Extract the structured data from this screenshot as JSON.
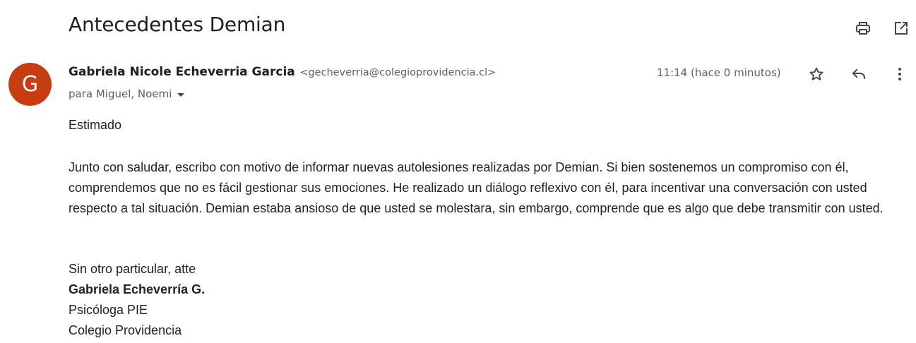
{
  "email": {
    "subject": "Antecedentes Demian",
    "sender": {
      "avatar_letter": "G",
      "name": "Gabriela Nicole Echeverria Garcia",
      "email": "<gecheverria@colegioprovidencia.cl>"
    },
    "recipients": "para Miguel, Noemi",
    "timestamp": "11:14 (hace 0 minutos)",
    "body": {
      "greeting": "Estimado",
      "paragraph": "Junto con saludar, escribo con motivo de informar nuevas autolesiones realizadas por Demian. Si bien sostenemos un compromiso con él, comprendemos que no es fácil gestionar sus emociones. He realizado un diálogo reflexivo con él, para incentivar una conversación con usted respecto a tal situación. Demian estaba ansioso de que usted se molestara, sin embargo, comprende que es algo que debe transmitir con usted.",
      "signoff": "Sin otro particular, atte",
      "signature_name": "Gabriela Echeverría G.",
      "signature_role": "Psicóloga PIE",
      "signature_org": "Colegio Providencia"
    }
  },
  "icons": {
    "print": "print-icon",
    "open_new_window": "open-in-new-window-icon",
    "star": "star-icon",
    "reply": "reply-icon",
    "more": "more-vert-icon",
    "recipients_toggle": "chevron-down-icon"
  },
  "colors": {
    "avatar_bg": "#c63d12",
    "primary_text": "#1f1f1f",
    "secondary_text": "#5e5e5e",
    "icon": "#444746"
  }
}
